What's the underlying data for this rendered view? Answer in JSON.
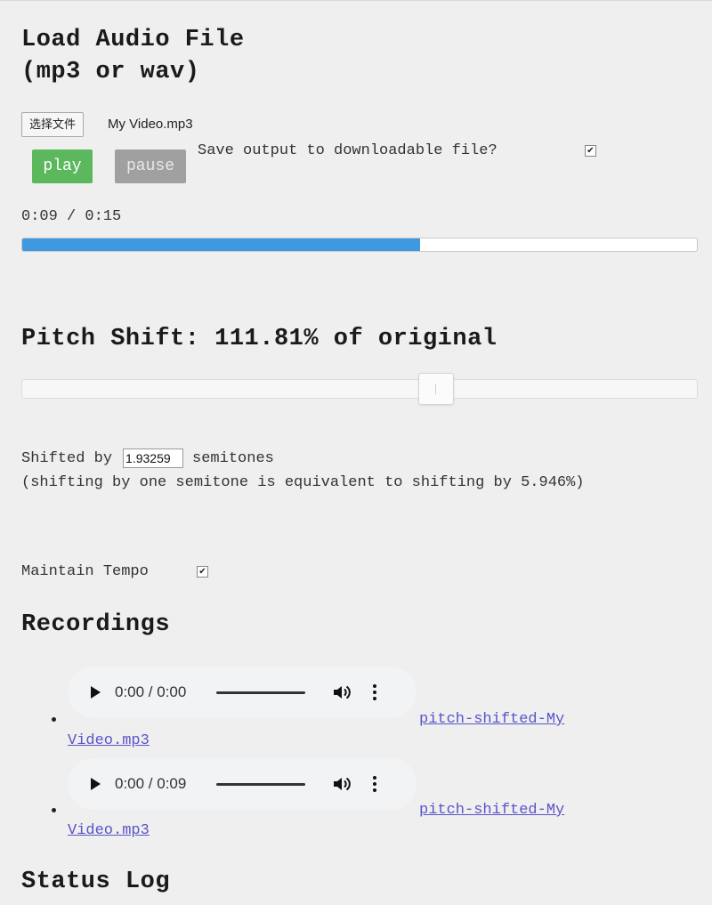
{
  "load_section": {
    "title_line1": "Load Audio File",
    "title_line2": "(mp3 or wav)",
    "file_button_label": "选择文件",
    "file_name": "My Video.mp3"
  },
  "controls": {
    "play_label": "play",
    "pause_label": "pause",
    "save_output_label": "Save output to downloadable file?",
    "save_output_checked": true,
    "play_color": "#5cb85c",
    "pause_color": "#a0a0a0"
  },
  "playback": {
    "time_text": "0:09 / 0:15",
    "progress_fraction": 0.59,
    "progress_color": "#3f99e0"
  },
  "pitch": {
    "title": "Pitch Shift: 111.81% of original",
    "slider_fraction": 0.62,
    "shift_prefix": "Shifted by",
    "semitones_value": "1.93259",
    "shift_suffix": "semitones",
    "note": "(shifting by one semitone is equivalent to shifting by 5.946%)"
  },
  "tempo": {
    "label": "Maintain Tempo",
    "checked": true
  },
  "recordings": {
    "title": "Recordings",
    "items": [
      {
        "player_time": "0:00 / 0:00",
        "link_line1": "pitch-shifted-My",
        "link_line2": "Video.mp3"
      },
      {
        "player_time": "0:00 / 0:09",
        "link_line1": "pitch-shifted-My",
        "link_line2": "Video.mp3"
      }
    ]
  },
  "status": {
    "title": "Status Log"
  },
  "icons": {
    "play": "play-icon",
    "volume": "volume-icon",
    "more": "more-vertical-icon",
    "checkbox": "checkmark-icon"
  }
}
